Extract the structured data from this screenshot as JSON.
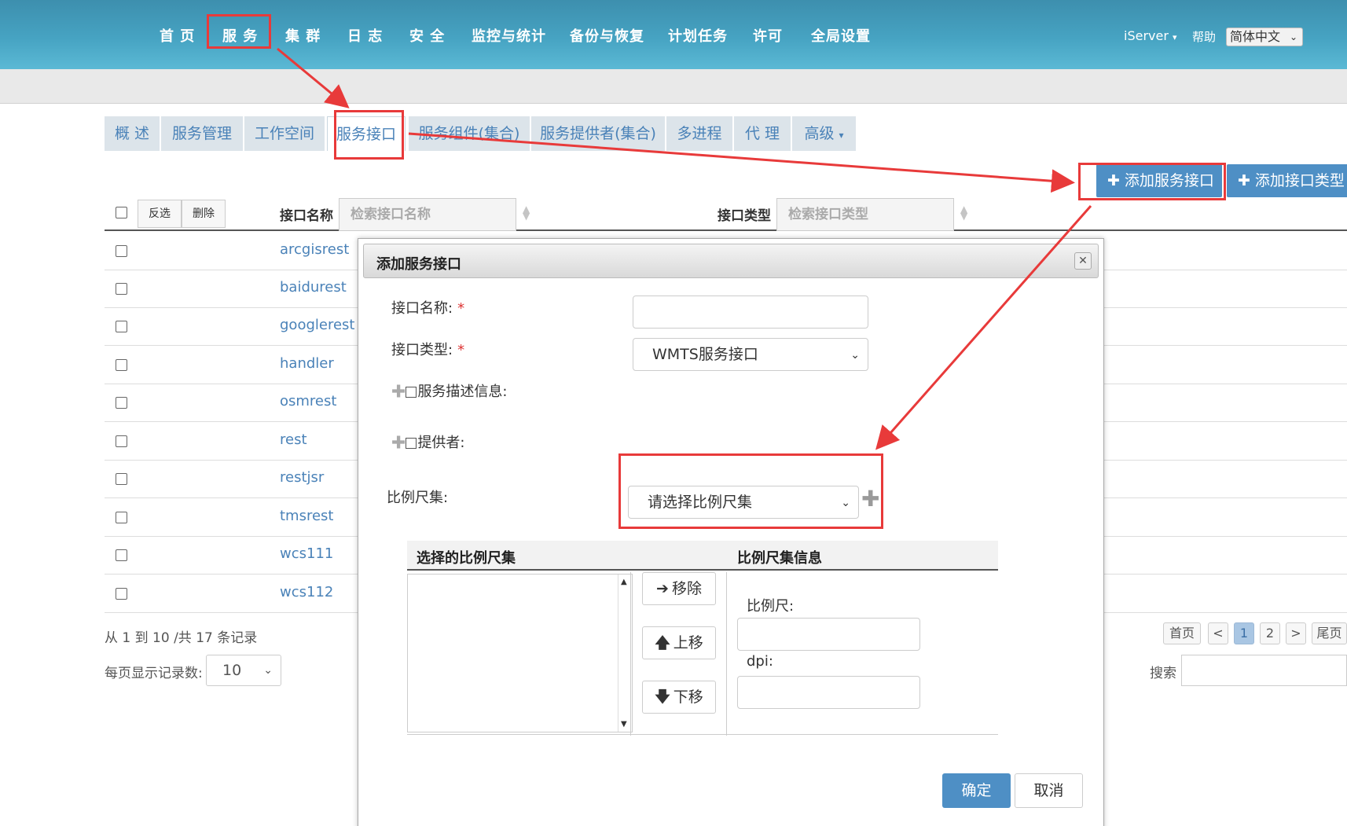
{
  "nav": {
    "items": [
      "首 页",
      "服 务",
      "集 群",
      "日 志",
      "安 全",
      "监控与统计",
      "备份与恢复",
      "计划任务",
      "许可",
      "全局设置"
    ],
    "user": "iServer",
    "user_caret": "▾",
    "help": "帮助",
    "language": "简体中文"
  },
  "tabs": [
    "概 述",
    "服务管理",
    "工作空间",
    "服务接口",
    "服务组件(集合)",
    "服务提供者(集合)",
    "多进程",
    "代 理",
    "高级"
  ],
  "tab_advanced_caret": "▾",
  "actions": {
    "add_interface": "添加服务接口",
    "add_interface_type": "添加接口类型"
  },
  "table": {
    "invert_select": "反选",
    "delete": "删除",
    "col_name": "接口名称",
    "col_name_placeholder": "检索接口名称",
    "col_type": "接口类型",
    "col_type_placeholder": "检索接口类型",
    "rows": [
      "arcgisrest",
      "baidurest",
      "googlerest",
      "handler",
      "osmrest",
      "rest",
      "restjsr",
      "tmsrest",
      "wcs111",
      "wcs112"
    ]
  },
  "pager": {
    "info": "从 1 到 10 /共 17 条记录",
    "per_page_label": "每页显示记录数:",
    "per_page_value": "10",
    "first": "首页",
    "prev": "<",
    "page1": "1",
    "page2": "2",
    "next": ">",
    "last": "尾页",
    "search_label": "搜索"
  },
  "dialog": {
    "title": "添加服务接口",
    "close": "✕",
    "name_label": "接口名称:",
    "required": "*",
    "type_label": "接口类型:",
    "type_value": "WMTS服务接口",
    "desc_label": "服务描述信息:",
    "provider_label": "提供者:",
    "scale_set_label": "比例尺集:",
    "scale_set_placeholder": "请选择比例尺集",
    "selected_sets_header": "选择的比例尺集",
    "set_info_header": "比例尺集信息",
    "remove": "移除",
    "move_up": "上移",
    "move_down": "下移",
    "scale_label": "比例尺:",
    "dpi_label": "dpi:",
    "ok": "确定",
    "cancel": "取消"
  },
  "colors": {
    "nav_bg": "#46a3c2",
    "accent": "#4e8fc5",
    "link": "#4a82b8",
    "highlight": "#e83a3a"
  }
}
